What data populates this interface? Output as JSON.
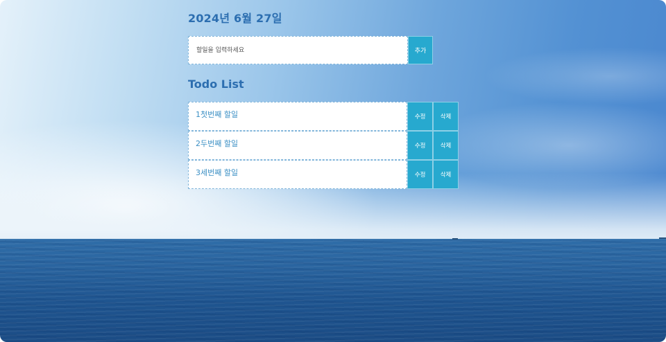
{
  "header": {
    "date": "2024년 6월 27일"
  },
  "form": {
    "placeholder": "할일을 입력하세요",
    "add_label": "추가"
  },
  "list": {
    "title": "Todo List",
    "items": [
      {
        "text": "1첫번째 할일",
        "edit_label": "수정",
        "delete_label": "삭제"
      },
      {
        "text": "2두번째 할일",
        "edit_label": "수정",
        "delete_label": "삭제"
      },
      {
        "text": "3세번째 할일",
        "edit_label": "수정",
        "delete_label": "삭제"
      }
    ]
  },
  "colors": {
    "accent": "#27a9cf",
    "heading": "#2c6eb0",
    "item_text": "#3b8fc4"
  }
}
